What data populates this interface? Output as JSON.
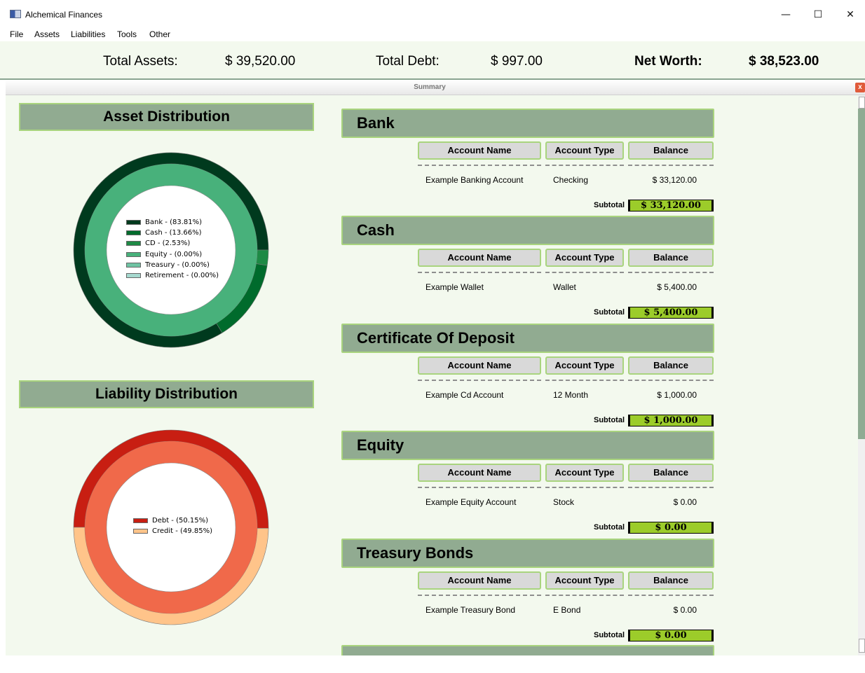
{
  "window": {
    "title": "Alchemical Finances",
    "controls": {
      "minimize": "—",
      "maximize": "☐",
      "close": "✕"
    }
  },
  "menu": [
    "File",
    "Assets",
    "Liabilities",
    "Tools",
    "Other"
  ],
  "totals": {
    "assets_label": "Total Assets:",
    "assets_value": "$ 39,520.00",
    "debt_label": "Total Debt:",
    "debt_value": "$ 997.00",
    "networth_label": "Net Worth:",
    "networth_value": "$ 38,523.00"
  },
  "summary": {
    "title": "Summary",
    "close": "x"
  },
  "asset_distribution": {
    "title": "Asset Distribution",
    "legend": [
      {
        "label": "Bank - (83.81%)",
        "color": "#003a1e"
      },
      {
        "label": "Cash - (13.66%)",
        "color": "#006b2c"
      },
      {
        "label": "CD - (2.53%)",
        "color": "#1e8a45"
      },
      {
        "label": "Equity - (0.00%)",
        "color": "#48b17b"
      },
      {
        "label": "Treasury - (0.00%)",
        "color": "#6fc3a3"
      },
      {
        "label": "Retirement - (0.00%)",
        "color": "#a6d9cf"
      }
    ]
  },
  "liability_distribution": {
    "title": "Liability Distribution",
    "legend": [
      {
        "label": "Debt - (50.15%)",
        "color": "#c81e12"
      },
      {
        "label": "Credit - (49.85%)",
        "color": "#ffc48a"
      }
    ]
  },
  "chart_data": [
    {
      "type": "pie",
      "title": "Asset Distribution",
      "categories": [
        "Bank",
        "Cash",
        "CD",
        "Equity",
        "Treasury",
        "Retirement"
      ],
      "values": [
        83.81,
        13.66,
        2.53,
        0.0,
        0.0,
        0.0
      ],
      "colors": [
        "#003a1e",
        "#006b2c",
        "#1e8a45",
        "#48b17b",
        "#6fc3a3",
        "#a6d9cf"
      ],
      "inner_ring_color": "#48b17b"
    },
    {
      "type": "pie",
      "title": "Liability Distribution",
      "categories": [
        "Debt",
        "Credit"
      ],
      "values": [
        50.15,
        49.85
      ],
      "colors": [
        "#c81e12",
        "#ffc48a"
      ],
      "inner_ring_color": "#f0694a"
    }
  ],
  "columns": [
    "Account Name",
    "Account Type",
    "Balance"
  ],
  "subtotal_label": "Subtotal",
  "sections": [
    {
      "title": "Bank",
      "rows": [
        {
          "name": "Example Banking Account",
          "type": "Checking",
          "balance": "$ 33,120.00"
        }
      ],
      "subtotal": "$ 33,120.00"
    },
    {
      "title": "Cash",
      "rows": [
        {
          "name": "Example Wallet",
          "type": "Wallet",
          "balance": "$ 5,400.00"
        }
      ],
      "subtotal": "$ 5,400.00"
    },
    {
      "title": "Certificate Of Deposit",
      "rows": [
        {
          "name": "Example Cd Account",
          "type": "12 Month",
          "balance": "$ 1,000.00"
        }
      ],
      "subtotal": "$ 1,000.00"
    },
    {
      "title": "Equity",
      "rows": [
        {
          "name": "Example Equity Account",
          "type": "Stock",
          "balance": "$ 0.00"
        }
      ],
      "subtotal": "$ 0.00"
    },
    {
      "title": "Treasury Bonds",
      "rows": [
        {
          "name": "Example Treasury Bond",
          "type": "E Bond",
          "balance": "$ 0.00"
        }
      ],
      "subtotal": "$ 0.00"
    }
  ]
}
